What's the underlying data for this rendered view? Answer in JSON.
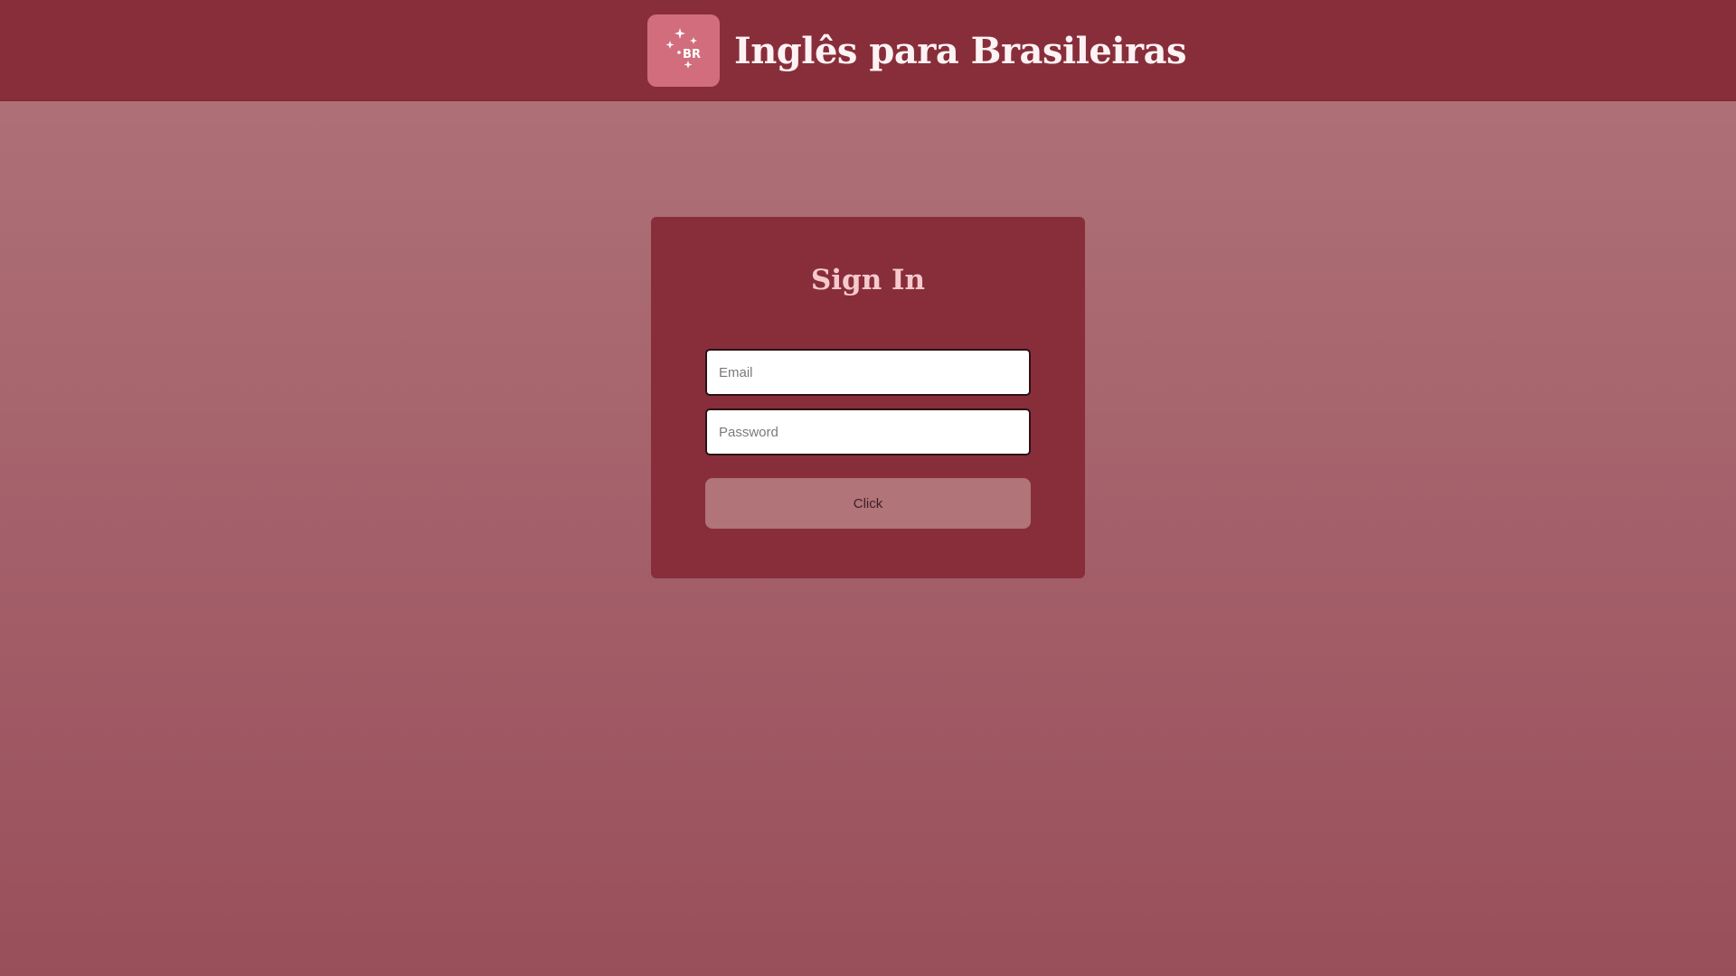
{
  "header": {
    "title": "Inglês para Brasileiras",
    "logo": {
      "icon": "sparkles-br-icon",
      "text": "BR",
      "background": "#d16d7d"
    },
    "background": "#882e3a"
  },
  "signin": {
    "title": "Sign In",
    "email": {
      "placeholder": "Email",
      "value": ""
    },
    "password": {
      "placeholder": "Password",
      "value": ""
    },
    "submit_label": "Click"
  },
  "colors": {
    "accent": "#882e3a",
    "title_text": "#f6c9cd",
    "button": "#b07479",
    "page_background_top": "#b07479",
    "page_background_bottom": "#994f5a"
  }
}
